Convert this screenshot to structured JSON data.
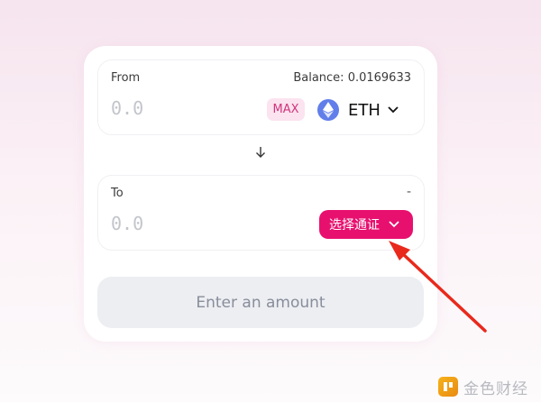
{
  "swap": {
    "from": {
      "label": "From",
      "balance": "Balance: 0.0169633",
      "amount_placeholder": "0.0",
      "max_label": "MAX",
      "token_symbol": "ETH",
      "token_icon": "ethereum-icon"
    },
    "switch_icon": "arrow-down-icon",
    "to": {
      "label": "To",
      "balance": "-",
      "amount_placeholder": "0.0",
      "select_token_label": "选择通证"
    },
    "submit_label": "Enter an amount"
  },
  "annotation": {
    "type": "red-arrow",
    "color": "#e8291c"
  },
  "watermark": {
    "text": "金色财经",
    "logo": "golden-finance-logo"
  },
  "colors": {
    "accent": "#e8106f",
    "max_bg": "#fbe3ef",
    "max_text": "#d0357c",
    "eth": "#627eea",
    "disabled_bg": "#edeef2",
    "disabled_text": "#888d9b"
  }
}
